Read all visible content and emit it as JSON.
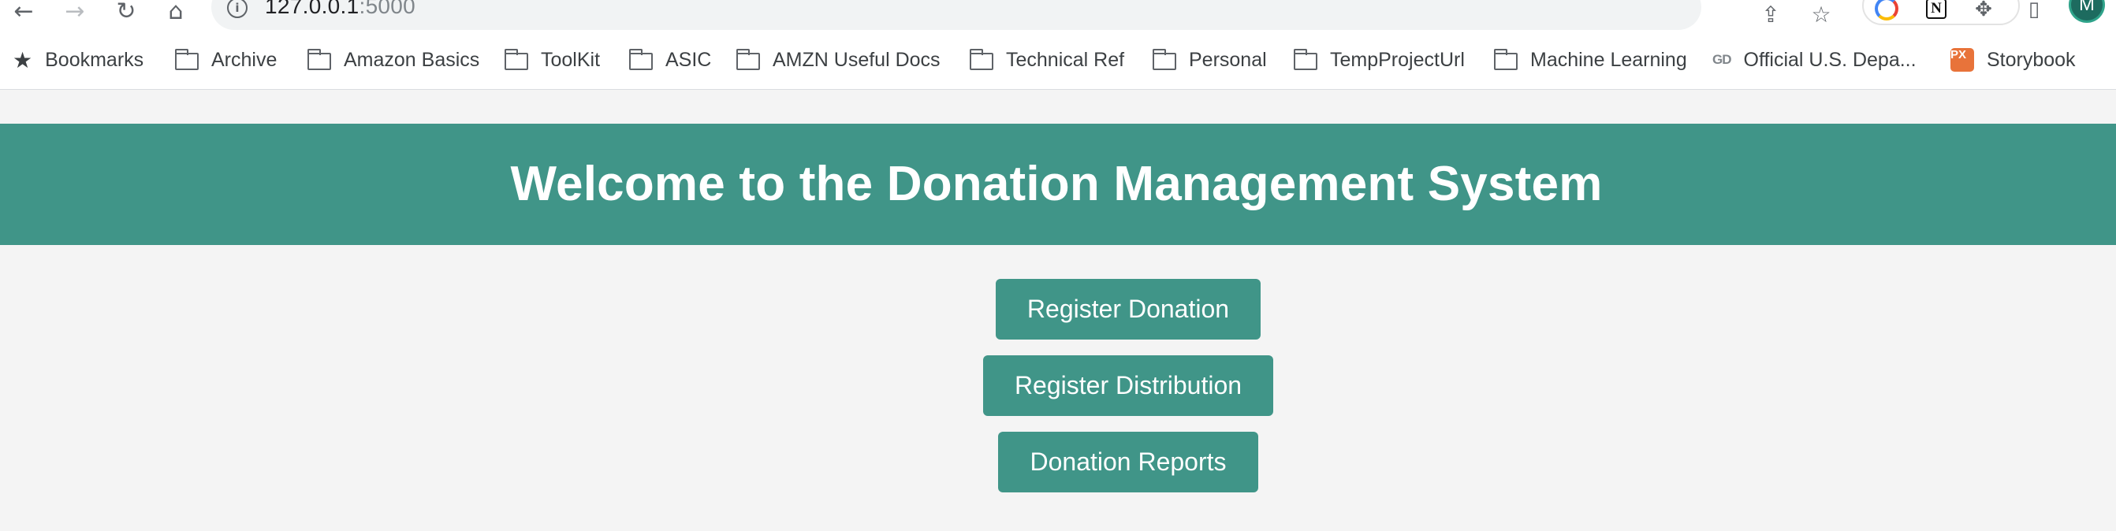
{
  "browser": {
    "url_host": "127.0.0.1",
    "url_port": ":5000",
    "profile_initial": "M",
    "icons": {
      "back": "back-arrow-icon",
      "forward": "forward-arrow-icon",
      "reload": "reload-icon",
      "home": "home-icon",
      "site_info": "info-icon",
      "share": "share-icon",
      "bookmark_star": "star-icon",
      "extensions": "puzzle-icon",
      "side_panel": "side-panel-icon"
    },
    "notion_letter": "N"
  },
  "bookmarks": [
    {
      "label": "Bookmarks",
      "icon": "star-icon"
    },
    {
      "label": "Archive",
      "icon": "folder-icon"
    },
    {
      "label": "Amazon Basics",
      "icon": "folder-icon"
    },
    {
      "label": "ToolKit",
      "icon": "folder-icon"
    },
    {
      "label": "ASIC",
      "icon": "folder-icon"
    },
    {
      "label": "AMZN Useful Docs",
      "icon": "folder-icon"
    },
    {
      "label": "Technical Ref",
      "icon": "folder-icon"
    },
    {
      "label": "Personal",
      "icon": "folder-icon"
    },
    {
      "label": "TempProjectUrl",
      "icon": "folder-icon"
    },
    {
      "label": "Machine Learning",
      "icon": "folder-icon"
    },
    {
      "label": "Official U.S. Depa...",
      "icon": "gd-icon",
      "icon_text": "GD"
    },
    {
      "label": "Storybook",
      "icon": "px-icon",
      "icon_text": "PX"
    }
  ],
  "page": {
    "title": "Welcome to the Donation Management System",
    "buttons": {
      "register_donation": "Register Donation",
      "register_distribution": "Register Distribution",
      "donation_reports": "Donation Reports"
    }
  },
  "colors": {
    "accent": "#409588",
    "page_background": "#f4f4f4"
  }
}
